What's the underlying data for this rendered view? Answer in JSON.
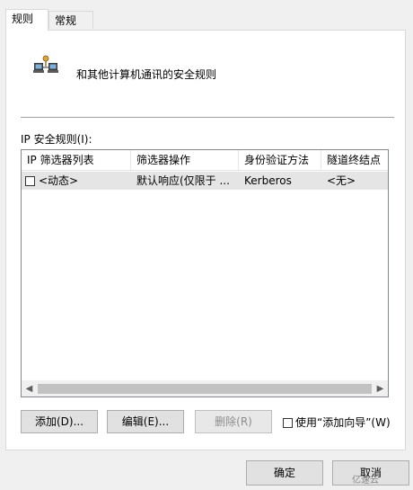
{
  "tabs": [
    {
      "label": "规则"
    },
    {
      "label": "常规"
    }
  ],
  "header": {
    "icon": "network-computers-icon",
    "text": "和其他计算机通讯的安全规则"
  },
  "list": {
    "label": "IP 安全规则(I):",
    "columns": [
      "IP 筛选器列表",
      "筛选器操作",
      "身份验证方法",
      "隧道终结点"
    ],
    "rows": [
      {
        "checked": false,
        "filter_list": "<动态>",
        "filter_action": "默认响应(仅限于 ...",
        "auth": "Kerberos",
        "tunnel": "<无>"
      }
    ]
  },
  "buttons": {
    "add": "添加(D)...",
    "edit": "编辑(E)...",
    "remove": "删除(R)",
    "wizard": "使用“添加向导”(W)",
    "ok": "确定",
    "cancel": "取消"
  },
  "watermark": "亿速云"
}
